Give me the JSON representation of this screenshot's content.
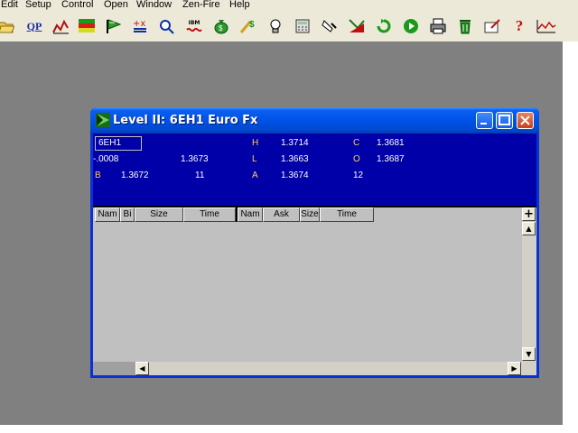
{
  "menu": {
    "items": [
      "Edit",
      "Setup",
      "Control",
      "Open",
      "Window",
      "Zen-Fire",
      "Help"
    ]
  },
  "toolbar": {
    "qp_label": "QP",
    "ibm_label": "IBM",
    "help_label": "?",
    "icons": [
      "folder-open-icon",
      "quote-page-icon",
      "chart-icon",
      "level-ii-icon",
      "flag-icon",
      "order-entry-icon",
      "query-icon",
      "ibm-icon",
      "money-bag-icon",
      "dollar-icon",
      "lightbulb-icon",
      "calculator-icon",
      "hand-icon",
      "alert-chart-icon",
      "refresh-icon",
      "play-icon",
      "print-icon",
      "trash-icon",
      "edit-icon",
      "help-icon",
      "mini-chart-icon"
    ]
  },
  "window": {
    "title": "Level II: 6EH1 Euro Fx",
    "symbol": "6EH1",
    "net_change": "-.0008",
    "last_price": "1.3673",
    "bid_label": "B",
    "bid_price": "1.3672",
    "bid_size": "11",
    "high_label": "H",
    "high_value": "1.3714",
    "low_label": "L",
    "low_value": "1.3663",
    "ask_label": "A",
    "ask_price": "1.3674",
    "ask_size": "12",
    "close_label": "C",
    "close_value": "1.3681",
    "open_label": "O",
    "open_value": "1.3687"
  },
  "table": {
    "columns": [
      "Nam",
      "Bi",
      "Size",
      "Time",
      "Nam",
      "Ask",
      "Size",
      "Time"
    ],
    "add_column_label": "+",
    "rows": []
  },
  "colors": {
    "titlebar": "#0053e6",
    "panel": "#0000a8",
    "label_yellow": "#ffd24a",
    "workspace": "#808080"
  }
}
